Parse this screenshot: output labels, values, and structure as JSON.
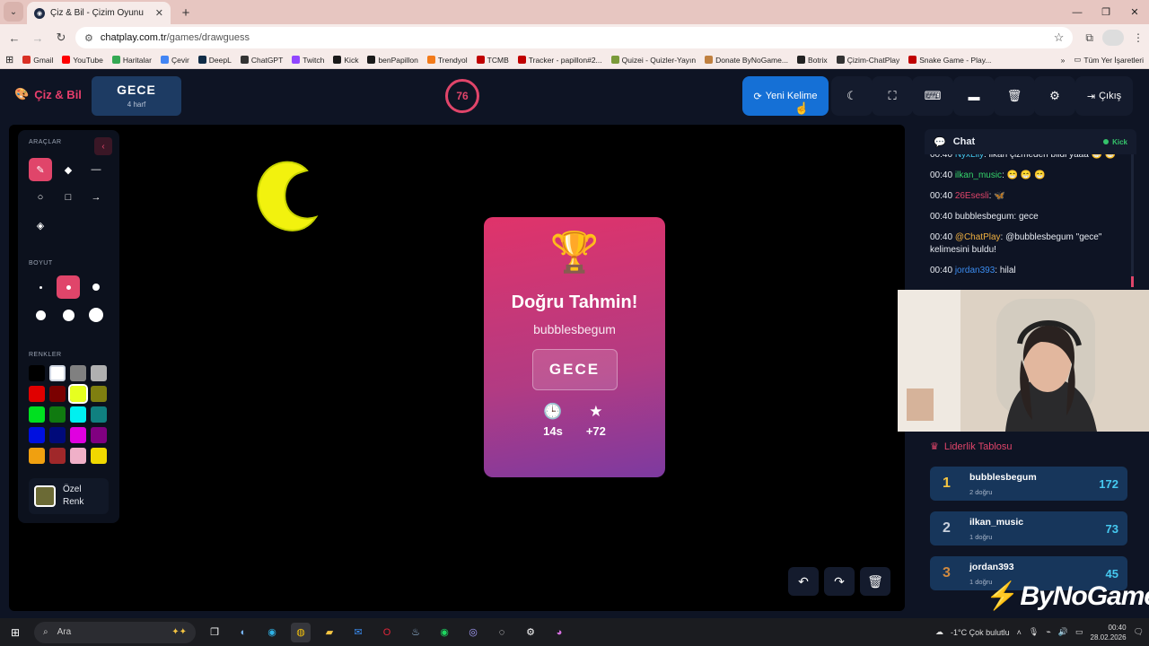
{
  "browser": {
    "tab_title": "Çiz & Bil - Çizim Oyunu",
    "url_host": "chatplay.com.tr",
    "url_path": "/games/drawguess",
    "bookmarks": [
      {
        "label": "Gmail",
        "color": "#d93025"
      },
      {
        "label": "YouTube",
        "color": "#ff0000"
      },
      {
        "label": "Haritalar",
        "color": "#34a853"
      },
      {
        "label": "Çevir",
        "color": "#4285f4"
      },
      {
        "label": "DeepL",
        "color": "#0f2b46"
      },
      {
        "label": "ChatGPT",
        "color": "#333333"
      },
      {
        "label": "Twitch",
        "color": "#9146ff"
      },
      {
        "label": "Kick",
        "color": "#1a1a1a"
      },
      {
        "label": "benPapillon",
        "color": "#1a1a1a"
      },
      {
        "label": "Trendyol",
        "color": "#f27a1a"
      },
      {
        "label": "TCMB",
        "color": "#c00000"
      },
      {
        "label": "Tracker - papillon#2...",
        "color": "#c00000"
      },
      {
        "label": "Quizei - Quizler-Yayın",
        "color": "#7a9a3a"
      },
      {
        "label": "Donate ByNoGame...",
        "color": "#c08040"
      },
      {
        "label": "Botrix",
        "color": "#222222"
      },
      {
        "label": "Çizim-ChatPlay",
        "color": "#333333"
      },
      {
        "label": "Snake Game - Play...",
        "color": "#c00000"
      }
    ],
    "all_bookmarks": "Tüm Yer İşaretleri"
  },
  "header": {
    "logo": "Çiz & Bil",
    "word": "GECE",
    "word_length": "4 harf",
    "timer": "76",
    "new_word": "Yeni Kelime",
    "exit": "Çıkış"
  },
  "tools": {
    "tools_title": "ARAÇLAR",
    "size_title": "BOYUT",
    "colors_title": "RENKLER",
    "custom_line1": "Özel",
    "custom_line2": "Renk",
    "palette": [
      "#000000",
      "#ffffff",
      "#808080",
      "#b0b0b0",
      "#e00000",
      "#7a0000",
      "#e6ff20",
      "#7f7f10",
      "#00e020",
      "#107a10",
      "#00f0f0",
      "#108080",
      "#0010e0",
      "#000a7a",
      "#e000e0",
      "#800080",
      "#f0a010",
      "#a0282a",
      "#f0b0c8",
      "#f0d800"
    ]
  },
  "result": {
    "title": "Doğru Tahmin!",
    "player": "bubblesbegum",
    "word": "GECE",
    "time": "14s",
    "points": "+72"
  },
  "chat": {
    "title": "Chat",
    "platform": "Kick",
    "messages": [
      {
        "time": "00:40",
        "user": "NyxLily",
        "color": "#46c9f0",
        "text": ": ilkan çizmeden bildi yaaa 😁 😁"
      },
      {
        "time": "00:40",
        "user": "ilkan_music",
        "color": "#35d46b",
        "text": ": 😁 😁 😁"
      },
      {
        "time": "00:40",
        "user": "26Esesli",
        "color": "#e0456a",
        "text": ": 🦋"
      },
      {
        "time": "00:40",
        "user": "",
        "color": "#e8ecf3",
        "text": "bubblesbegum: gece"
      },
      {
        "time": "00:40",
        "user": "@ChatPlay",
        "color": "#f0b040",
        "text": ": @bubblesbegum \"gece\" kelimesini buldu!"
      },
      {
        "time": "00:40",
        "user": "jordan393",
        "color": "#3b8cf0",
        "text": ": hilal"
      }
    ]
  },
  "leaderboard": {
    "title": "Liderlik Tablosu",
    "rows": [
      {
        "rank": "1",
        "rank_color": "#f5c542",
        "name": "bubblesbegum",
        "sub": "2 doğru",
        "points": "172"
      },
      {
        "rank": "2",
        "rank_color": "#c8d0dc",
        "name": "ilkan_music",
        "sub": "1 doğru",
        "points": "73"
      },
      {
        "rank": "3",
        "rank_color": "#d08a40",
        "name": "jordan393",
        "sub": "1 doğru",
        "points": "45"
      }
    ]
  },
  "brand": "ByNoGame",
  "taskbar": {
    "search": "Ara",
    "weather": "-1°C  Çok bulutlu",
    "time": "00:40",
    "date": "28.02.2026"
  }
}
